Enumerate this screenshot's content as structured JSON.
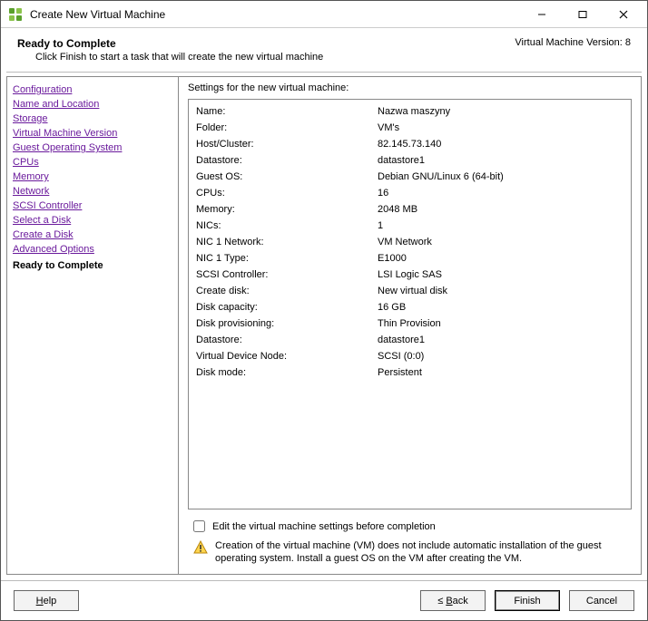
{
  "window": {
    "title": "Create New Virtual Machine"
  },
  "header": {
    "title": "Ready to Complete",
    "subtitle": "Click Finish to start a task that will create the new virtual machine",
    "version_label": "Virtual Machine Version: 8"
  },
  "sidebar": {
    "items": [
      "Configuration",
      "Name and Location",
      "Storage",
      "Virtual Machine Version",
      "Guest Operating System",
      "CPUs",
      "Memory",
      "Network",
      "SCSI Controller",
      "Select a Disk",
      "Create a Disk",
      "Advanced Options"
    ],
    "current": "Ready to Complete"
  },
  "main": {
    "section_title": "Settings for the new virtual machine:",
    "rows": [
      {
        "k": "Name:",
        "v": "Nazwa maszyny"
      },
      {
        "k": "Folder:",
        "v": "VM's"
      },
      {
        "k": "Host/Cluster:",
        "v": "82.145.73.140"
      },
      {
        "k": "Datastore:",
        "v": "datastore1"
      },
      {
        "k": "Guest OS:",
        "v": "Debian GNU/Linux 6 (64-bit)"
      },
      {
        "k": "CPUs:",
        "v": "16"
      },
      {
        "k": "Memory:",
        "v": "2048 MB"
      },
      {
        "k": "NICs:",
        "v": "1"
      },
      {
        "k": "NIC 1 Network:",
        "v": "VM Network"
      },
      {
        "k": "NIC 1 Type:",
        "v": "E1000"
      },
      {
        "k": "SCSI Controller:",
        "v": "LSI Logic SAS"
      },
      {
        "k": "Create disk:",
        "v": "New virtual disk"
      },
      {
        "k": "Disk capacity:",
        "v": "16 GB"
      },
      {
        "k": "Disk provisioning:",
        "v": "Thin Provision"
      },
      {
        "k": "Datastore:",
        "v": "datastore1"
      },
      {
        "k": "Virtual Device Node:",
        "v": "SCSI (0:0)"
      },
      {
        "k": "Disk mode:",
        "v": "Persistent"
      }
    ],
    "edit_label": "Edit the virtual machine settings before completion",
    "warning": "Creation of the virtual machine (VM) does not include automatic installation of the guest operating system. Install a guest OS on the VM after creating the VM."
  },
  "footer": {
    "help": "Help",
    "back": "Back",
    "finish": "Finish",
    "cancel": "Cancel"
  }
}
